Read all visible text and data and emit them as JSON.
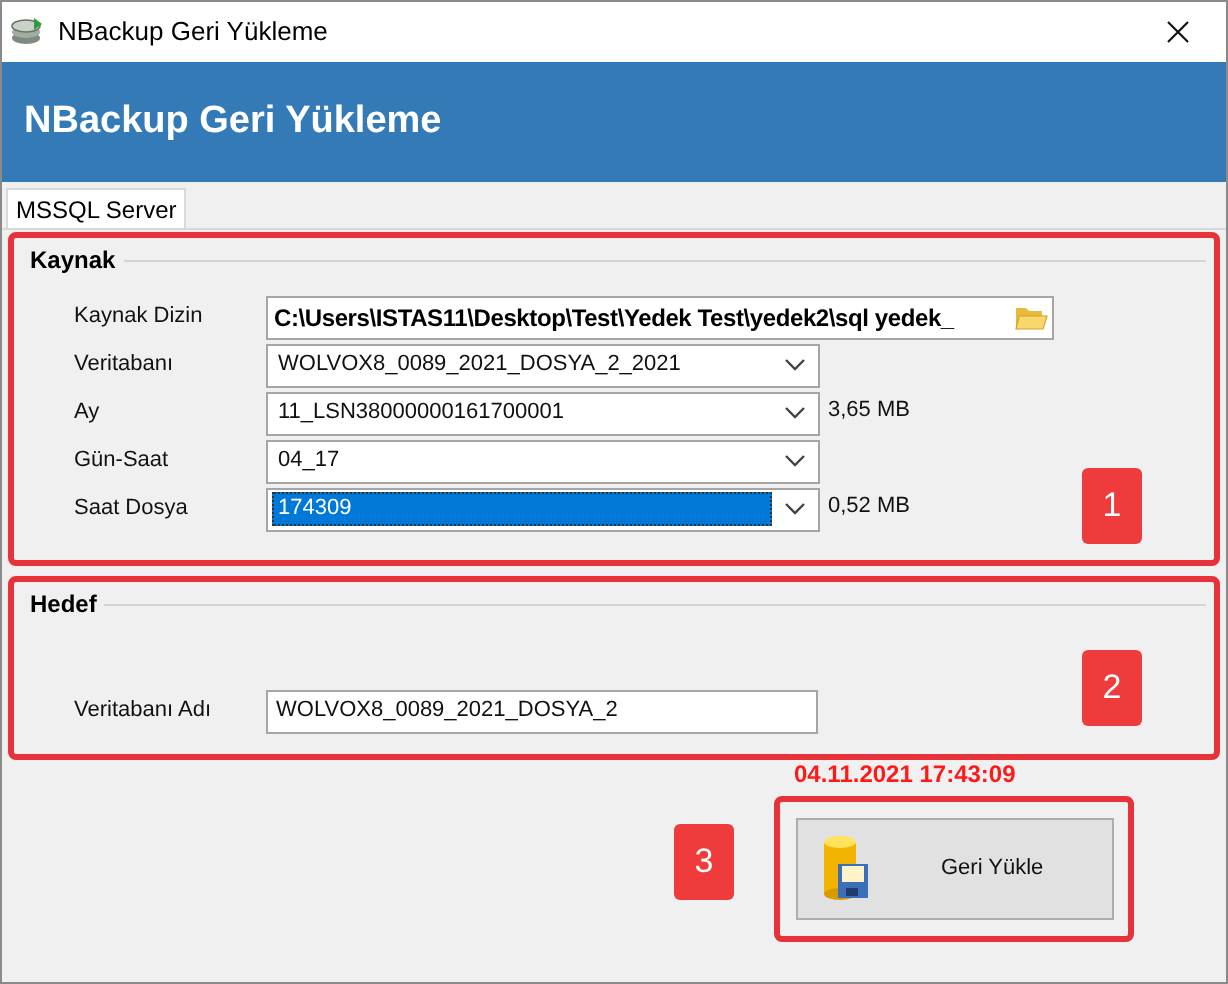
{
  "window": {
    "title": "NBackup Geri Yükleme"
  },
  "header": {
    "title": "NBackup Geri Yükleme"
  },
  "tabs": [
    {
      "label": "MSSQL Server",
      "selected": true
    }
  ],
  "source": {
    "title": "Kaynak",
    "annotation": "1",
    "fields": [
      {
        "kind": "path",
        "label": "Kaynak Dizin",
        "value": "C:\\Users\\ISTAS11\\Desktop\\Test\\Yedek Test\\yedek2\\sql yedek_"
      },
      {
        "kind": "combo",
        "label": "Veritabanı",
        "value": "WOLVOX8_0089_2021_DOSYA_2_2021",
        "highlighted": false
      },
      {
        "kind": "combo",
        "label": "Ay",
        "value": "11_LSN38000000161700001",
        "size": "3,65 MB",
        "highlighted": false
      },
      {
        "kind": "combo",
        "label": "Gün-Saat",
        "value": "04_17",
        "highlighted": false
      },
      {
        "kind": "combo",
        "label": "Saat Dosya",
        "value": "174309",
        "size": "0,52 MB",
        "highlighted": true
      }
    ]
  },
  "target": {
    "title": "Hedef",
    "annotation": "2",
    "fields": [
      {
        "kind": "text",
        "label": "Veritabanı Adı",
        "value": "WOLVOX8_0089_2021_DOSYA_2"
      }
    ]
  },
  "timestamp": "04.11.2021 17:43:09",
  "restore": {
    "label": "Geri Yükle",
    "annotation": "3"
  }
}
